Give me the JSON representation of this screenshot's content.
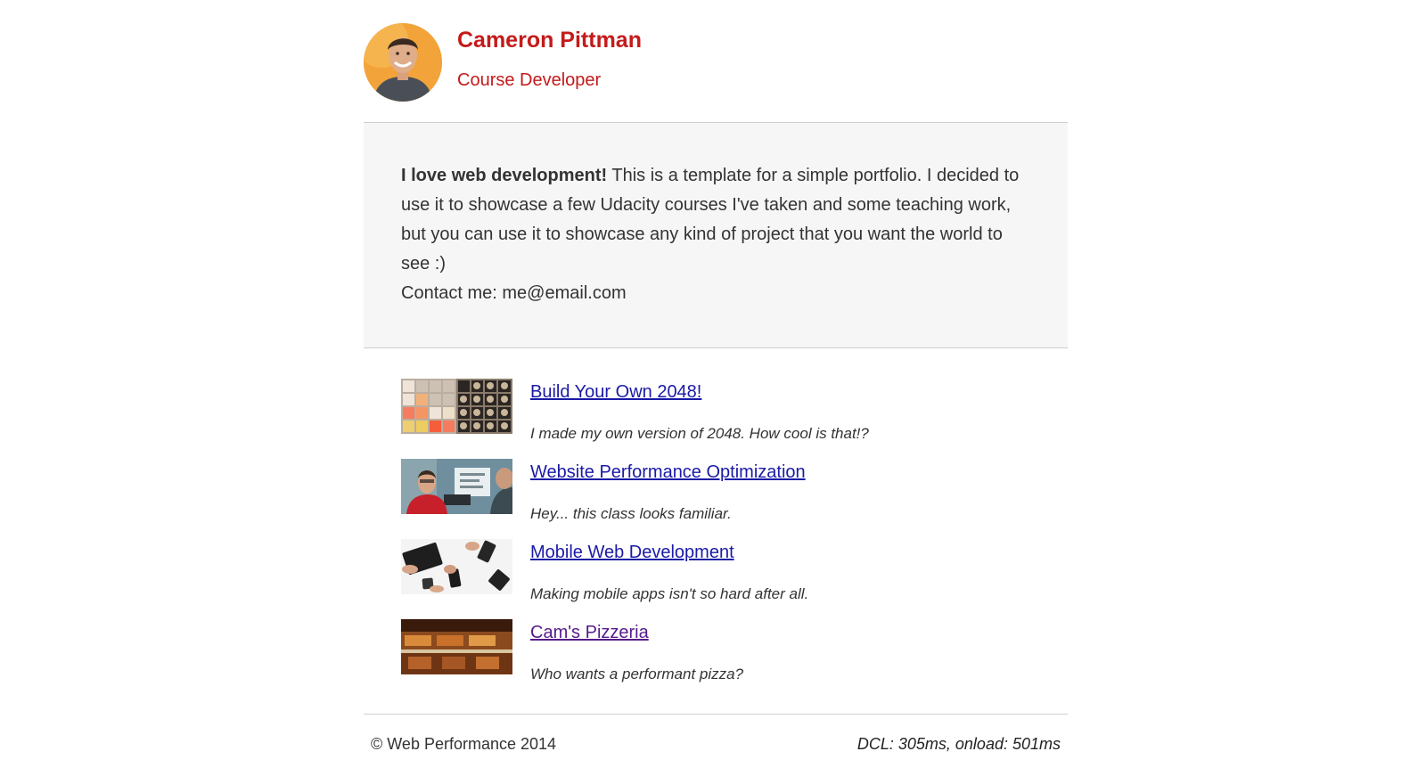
{
  "header": {
    "name": "Cameron Pittman",
    "role": "Course Developer",
    "accent_color": "#c41a1a"
  },
  "bio": {
    "lead": "I love web development!",
    "text": " This is a template for a simple portfolio. I decided to use it to showcase a few Udacity courses I've taken and some teaching work, but you can use it to showcase any kind of project that you want the world to see :)",
    "contact": "Contact me: me@email.com"
  },
  "projects": [
    {
      "title": "Build Your Own 2048!",
      "description": "I made my own version of 2048. How cool is that!?",
      "visited": false,
      "thumb": "2048-grid-thumbnail"
    },
    {
      "title": "Website Performance Optimization",
      "description": "Hey... this class looks familiar.",
      "visited": false,
      "thumb": "course-video-thumbnail"
    },
    {
      "title": "Mobile Web Development",
      "description": "Making mobile apps isn't so hard after all.",
      "visited": false,
      "thumb": "mobile-devices-thumbnail"
    },
    {
      "title": "Cam's Pizzeria",
      "description": "Who wants a performant pizza?",
      "visited": true,
      "thumb": "pizzeria-thumbnail"
    }
  ],
  "footer": {
    "copyright": "© Web Performance 2014",
    "perf": "DCL: 305ms, onload: 501ms"
  },
  "colors": {
    "link": "#1a1aa6",
    "link_visited": "#551a8b",
    "bio_background": "#f6f6f6"
  }
}
